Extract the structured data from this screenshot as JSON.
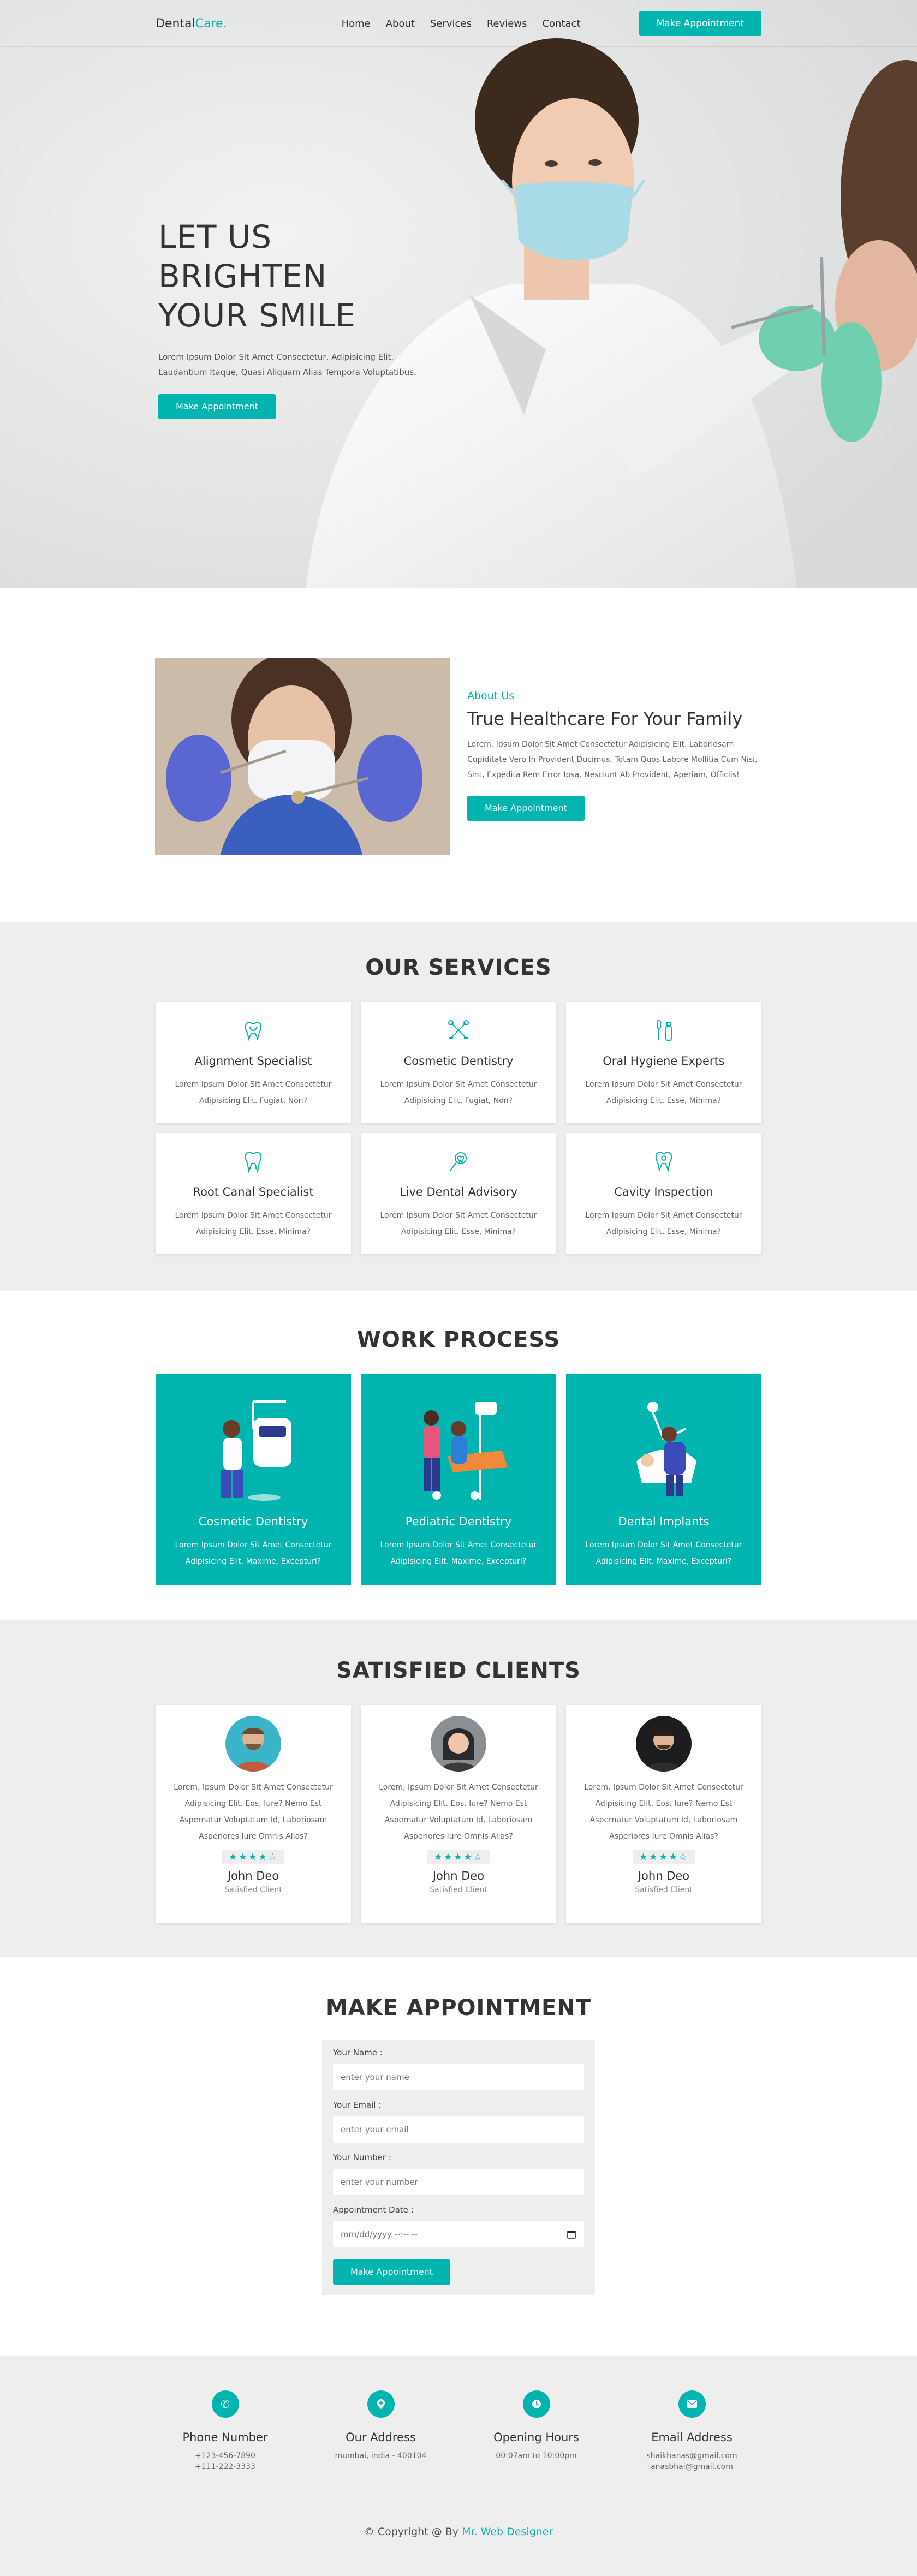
{
  "header": {
    "logo_main": "Dental",
    "logo_accent": "Care.",
    "nav": [
      "Home",
      "About",
      "Services",
      "Reviews",
      "Contact"
    ],
    "cta": "Make Appointment"
  },
  "hero": {
    "title_line1": "LET US BRIGHTEN",
    "title_line2": "YOUR SMILE",
    "text": "Lorem Ipsum Dolor Sit Amet Consectetur, Adipisicing Elit. Laudantium Itaque, Quasi Aliquam Alias Tempora Voluptatibus.",
    "cta": "Make Appointment"
  },
  "about": {
    "subtitle": "About Us",
    "title": "True Healthcare For Your Family",
    "text": "Lorem, Ipsum Dolor Sit Amet Consectetur Adipisicing Elit. Laboriosam Cupiditate Vero In Provident Ducimus. Totam Quos Labore Mollitia Cum Nisi, Sint, Expedita Rem Error Ipsa. Nesciunt Ab Provident, Aperiam, Officiis!",
    "cta": "Make Appointment"
  },
  "services": {
    "title": "OUR SERVICES",
    "items": [
      {
        "icon": "tooth-icon",
        "name": "Alignment Specialist",
        "text": "Lorem Ipsum Dolor Sit Amet Consectetur Adipisicing Elit. Fugiat, Non?"
      },
      {
        "icon": "dental-tools-icon",
        "name": "Cosmetic Dentistry",
        "text": "Lorem Ipsum Dolor Sit Amet Consectetur Adipisicing Elit. Fugiat, Non?"
      },
      {
        "icon": "toothbrush-icon",
        "name": "Oral Hygiene Experts",
        "text": "Lorem Ipsum Dolor Sit Amet Consectetur Adipisicing Elit. Esse, Minima?"
      },
      {
        "icon": "tooth-root-icon",
        "name": "Root Canal Specialist",
        "text": "Lorem Ipsum Dolor Sit Amet Consectetur Adipisicing Elit. Esse, Minima?"
      },
      {
        "icon": "mirror-tooth-icon",
        "name": "Live Dental Advisory",
        "text": "Lorem Ipsum Dolor Sit Amet Consectetur Adipisicing Elit. Esse, Minima?"
      },
      {
        "icon": "tooth-inspection-icon",
        "name": "Cavity Inspection",
        "text": "Lorem Ipsum Dolor Sit Amet Consectetur Adipisicing Elit. Esse, Minima?"
      }
    ]
  },
  "process": {
    "title": "WORK PROCESS",
    "items": [
      {
        "name": "Cosmetic Dentistry",
        "text": "Lorem Ipsum Dolor Sit Amet Consectetur Adipisicing Elit. Maxime, Excepturi?"
      },
      {
        "name": "Pediatric Dentistry",
        "text": "Lorem Ipsum Dolor Sit Amet Consectetur Adipisicing Elit. Maxime, Excepturi?"
      },
      {
        "name": "Dental Implants",
        "text": "Lorem Ipsum Dolor Sit Amet Consectetur Adipisicing Elit. Maxime, Excepturi?"
      }
    ]
  },
  "clients": {
    "title": "SATISFIED CLIENTS",
    "items": [
      {
        "text": "Lorem, Ipsum Dolor Sit Amet Consectetur Adipisicing Elit. Eos, Iure? Nemo Est Aspernatur Voluptatum Id, Laboriosam Asperiores Iure Omnis Alias?",
        "rating": 4.5,
        "stars": "★★★★☆",
        "name": "John Deo",
        "role": "Satisfied Client"
      },
      {
        "text": "Lorem, Ipsum Dolor Sit Amet Consectetur Adipisicing Elit. Eos, Iure? Nemo Est Aspernatur Voluptatum Id, Laboriosam Asperiores Iure Omnis Alias?",
        "rating": 4.5,
        "stars": "★★★★☆",
        "name": "John Deo",
        "role": "Satisfied Client"
      },
      {
        "text": "Lorem, Ipsum Dolor Sit Amet Consectetur Adipisicing Elit. Eos, Iure? Nemo Est Aspernatur Voluptatum Id, Laboriosam Asperiores Iure Omnis Alias?",
        "rating": 4.5,
        "stars": "★★★★☆",
        "name": "John Deo",
        "role": "Satisfied Client"
      }
    ]
  },
  "appointment": {
    "title": "MAKE APPOINTMENT",
    "name_label": "Your Name :",
    "name_placeholder": "enter your name",
    "email_label": "Your Email :",
    "email_placeholder": "enter your email",
    "number_label": "Your Number :",
    "number_placeholder": "enter your number",
    "date_label": "Appointment Date :",
    "date_placeholder": "mm/dd/yyyy --:-- --",
    "submit": "Make Appointment"
  },
  "footer": {
    "cols": [
      {
        "icon": "phone-icon",
        "title": "Phone Number",
        "line1": "+123-456-7890",
        "line2": "+111-222-3333"
      },
      {
        "icon": "location-pin-icon",
        "title": "Our Address",
        "line1": "mumbai, india - 400104",
        "line2": ""
      },
      {
        "icon": "clock-icon",
        "title": "Opening Hours",
        "line1": "00:07am to 10:00pm",
        "line2": ""
      },
      {
        "icon": "envelope-icon",
        "title": "Email Address",
        "line1": "shaikhanas@gmail.com",
        "line2": "anasbhai@gmail.com"
      }
    ],
    "copy_prefix": "© Copyright @ By",
    "copy_author": "Mr. Web Designer"
  },
  "colors": {
    "accent": "#00b4b0",
    "section_bg": "#eeeeee",
    "text": "#333333"
  }
}
